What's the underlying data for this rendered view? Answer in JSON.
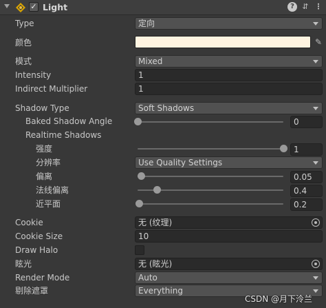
{
  "header": {
    "title": "Light",
    "enabled_check": "✓",
    "help_glyph": "?",
    "presets_glyph": "⇵",
    "more_glyph": "⋮"
  },
  "props": {
    "type": {
      "label": "Type",
      "value": "定向"
    },
    "color": {
      "label": "颜色",
      "value": "#fff4e1"
    },
    "mode": {
      "label": "模式",
      "value": "Mixed"
    },
    "intensity": {
      "label": "Intensity",
      "value": "1"
    },
    "indirect": {
      "label": "Indirect Multiplier",
      "value": "1"
    },
    "shadow_type": {
      "label": "Shadow Type",
      "value": "Soft Shadows"
    },
    "baked_angle": {
      "label": "Baked Shadow Angle",
      "value": "0",
      "fraction": 0.0
    },
    "realtime_shadows": {
      "label": "Realtime Shadows"
    },
    "strength": {
      "label": "强度",
      "value": "1",
      "fraction": 1.0
    },
    "resolution": {
      "label": "分辨率",
      "value": "Use Quality Settings"
    },
    "bias": {
      "label": "偏离",
      "value": "0.05",
      "fraction": 0.025
    },
    "normal_bias": {
      "label": "法线偏离",
      "value": "0.4",
      "fraction": 0.13
    },
    "near_plane": {
      "label": "近平面",
      "value": "0.2",
      "fraction": 0.01
    },
    "cookie": {
      "label": "Cookie",
      "value": "无 (纹理)"
    },
    "cookie_size": {
      "label": "Cookie Size",
      "value": "10"
    },
    "draw_halo": {
      "label": "Draw Halo",
      "checked": false
    },
    "flare": {
      "label": "眩光",
      "value": "无 (眩光)"
    },
    "render_mode": {
      "label": "Render Mode",
      "value": "Auto"
    },
    "culling_mask": {
      "label": "剔除遮罩",
      "value": "Everything"
    }
  },
  "watermark": "CSDN @月下泠兰"
}
